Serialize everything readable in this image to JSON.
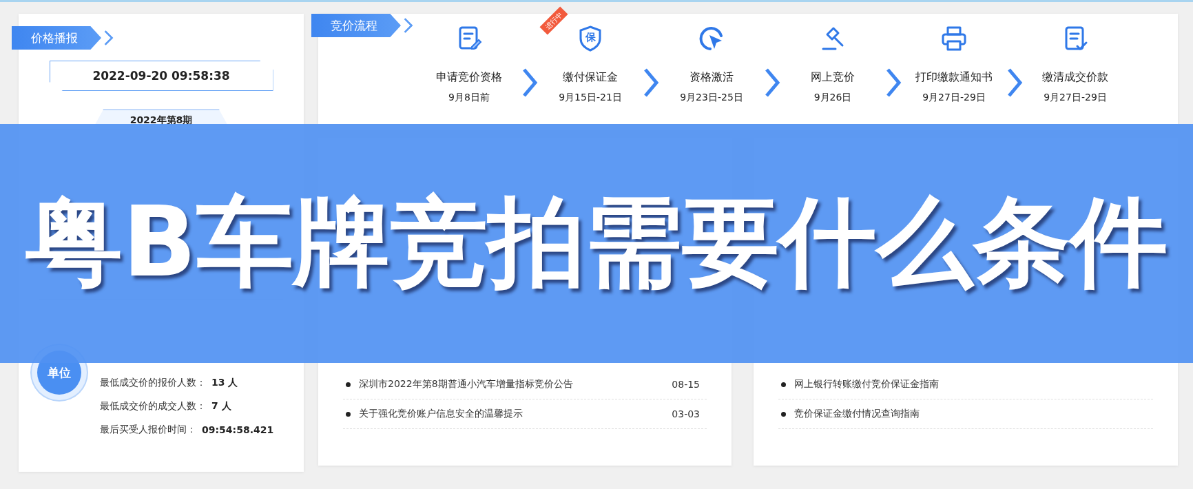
{
  "price_report": {
    "tag": "价格播报",
    "datetime": "2022-09-20 09:58:38",
    "period_tab": "2022年第8期",
    "badge": "单位",
    "section_2": [
      {
        "label": "最低成交价的报价人数：",
        "value": "13 人"
      },
      {
        "label": "最低成交价的成交人数：",
        "value": "7 人"
      },
      {
        "label": "最后买受人报价时间：",
        "value": "09:54:58.421"
      }
    ]
  },
  "process": {
    "tag": "竞价流程",
    "steps": [
      {
        "kind": "form",
        "name": "申请竞价资格",
        "date": "9月8日前"
      },
      {
        "kind": "shield",
        "name": "缴付保证金",
        "date": "9月15日-21日",
        "glyph": "保",
        "ribbon": "进行中"
      },
      {
        "kind": "cursor",
        "name": "资格激活",
        "date": "9月23日-25日"
      },
      {
        "kind": "gavel",
        "name": "网上竞价",
        "date": "9月26日"
      },
      {
        "kind": "printer",
        "name": "打印缴款通知书",
        "date": "9月27日-29日"
      },
      {
        "kind": "checklist",
        "name": "缴清成交价款",
        "date": "9月27日-29日"
      }
    ]
  },
  "announcements": {
    "items": [
      {
        "title": "深圳市2022年第8期普通小汽车增量指标竞价公告",
        "date": "08-15"
      },
      {
        "title": "关于强化竞价账户信息安全的温馨提示",
        "date": "03-03"
      }
    ]
  },
  "notices": {
    "items": [
      {
        "title": "网上银行转账缴付竞价保证金指南"
      },
      {
        "title": "竞价保证金缴付情况查询指南"
      }
    ]
  },
  "banner": {
    "title": "粤B车牌竞拍需要什么条件"
  }
}
